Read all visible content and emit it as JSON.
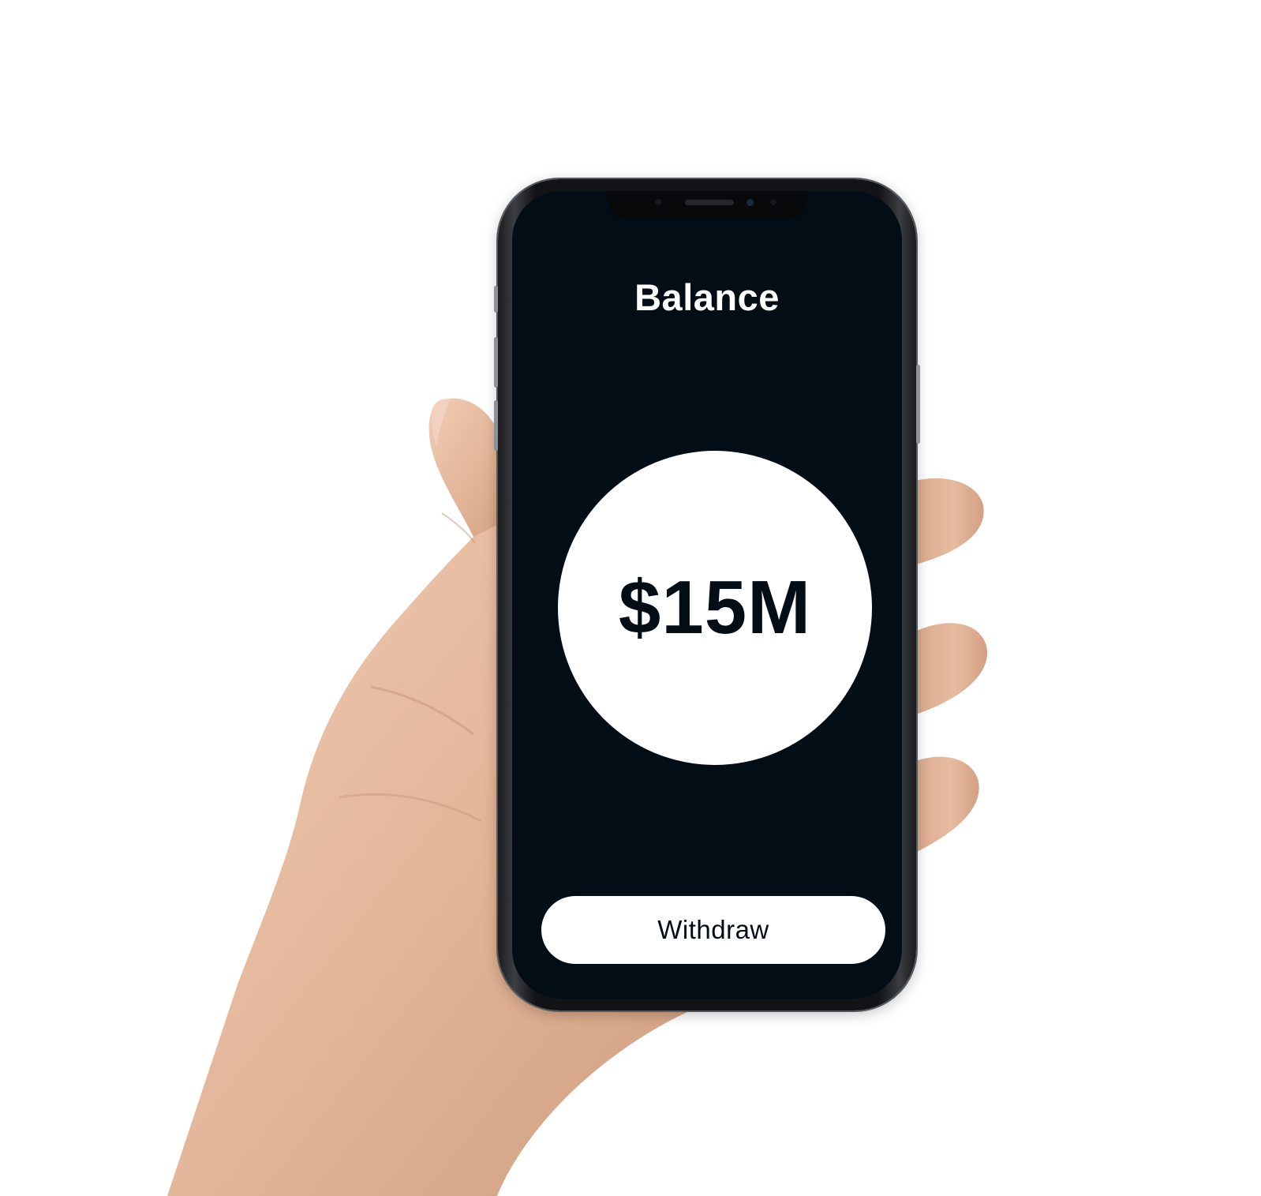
{
  "screen": {
    "title": "Balance",
    "balance_amount": "$15M",
    "withdraw_label": "Withdraw"
  },
  "colors": {
    "screen_background": "#020d16",
    "circle": "#ffffff",
    "button": "#ffffff",
    "text_dark": "#020d16",
    "text_light": "#ffffff",
    "skin": "#e4b99c"
  }
}
